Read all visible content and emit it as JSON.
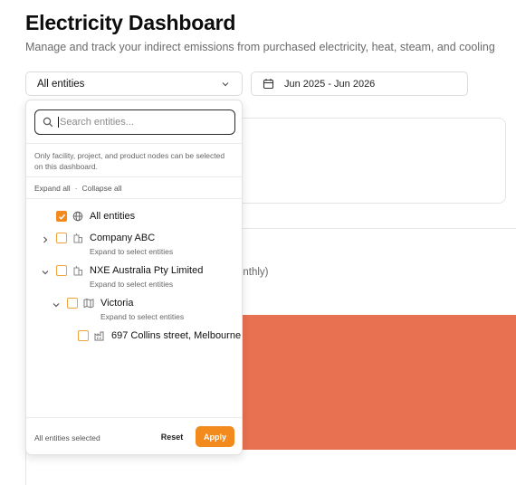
{
  "header": {
    "title": "Electricity Dashboard",
    "subtitle": "Manage and track your indirect emissions from purchased electricity, heat, steam, and cooling"
  },
  "filters": {
    "entity_selected": "All entities",
    "date_range": "Jun 2025 - Jun 2026"
  },
  "background": {
    "monthly_fragment": "onthly)"
  },
  "dropdown": {
    "search_placeholder": "Search entities...",
    "search_value": "",
    "note": "Only facility, project, and product nodes can be selected on this dashboard.",
    "expand_all": "Expand all",
    "separator": "·",
    "collapse_all": "Collapse all",
    "tree": [
      {
        "label": "All entities",
        "checked": true,
        "icon": "globe-icon"
      },
      {
        "label": "Company ABC",
        "hint": "Expand to select entities",
        "checked": false,
        "expanded": false,
        "icon": "building-icon"
      },
      {
        "label": "NXE Australia Pty Limited",
        "hint": "Expand to select entities",
        "checked": false,
        "expanded": true,
        "icon": "building-icon"
      },
      {
        "label": "Victoria",
        "hint": "Expand to select entities",
        "checked": false,
        "expanded": true,
        "icon": "map-icon"
      },
      {
        "label": "697 Collins street, Melbourne",
        "checked": false,
        "icon": "factory-icon"
      }
    ],
    "status": "All entities selected",
    "reset_label": "Reset",
    "apply_label": "Apply"
  },
  "colors": {
    "accent": "#f28a1e",
    "bar": "#e87152"
  }
}
